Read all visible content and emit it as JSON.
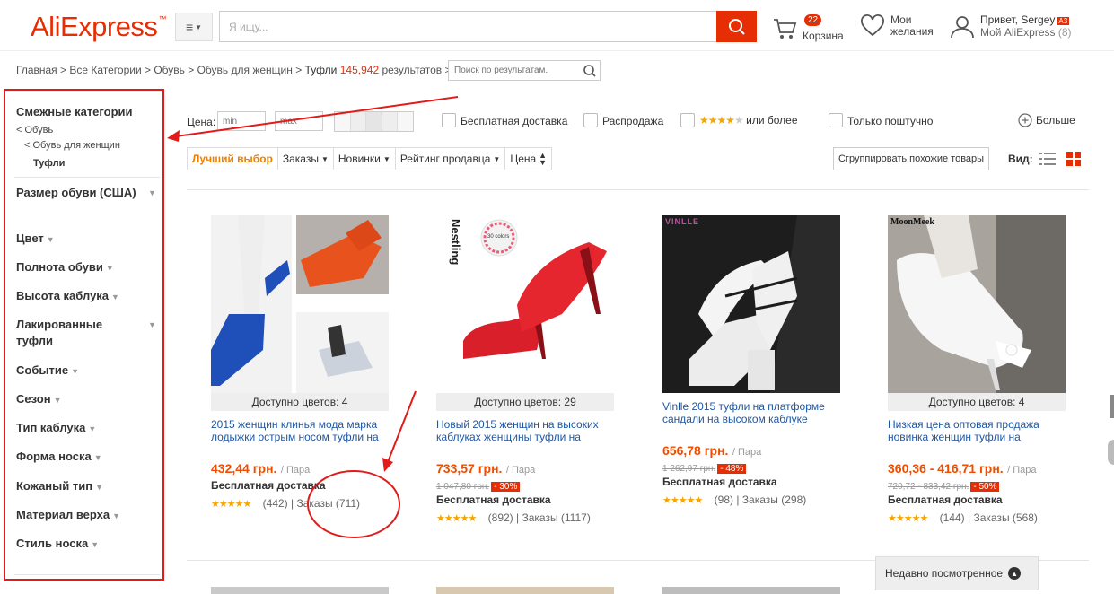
{
  "header": {
    "logo": "AliExpress",
    "logo_tm": "™",
    "search_placeholder": "Я ищу...",
    "cart_count": "22",
    "cart_label": "Корзина",
    "wish_line1": "Мои",
    "wish_line2": "желания",
    "greet_line1": "Привет, Sergey",
    "level_badge": "A3",
    "greet_line2": "Мой AliExpress",
    "greet_count": "(8)"
  },
  "breadcrumb": {
    "path": "Главная > Все Категории > Обувь > Обувь для женщин > ",
    "current": "Туфли",
    "count": "145,942",
    "results_label": "результатов",
    "arrow": ">",
    "search_placeholder": "Поиск по результатам."
  },
  "sidebar": {
    "title": "Смежные категории",
    "links": [
      "< Обувь",
      "< Обувь для женщин",
      "Туфли"
    ],
    "facets": [
      "Размер обуви (США)",
      "Цвет",
      "Полнота обуви",
      "Высота каблука",
      "Лакированные туфли",
      "Событие",
      "Сезон",
      "Тип каблука",
      "Форма носка",
      "Кожаный тип",
      "Материал верха",
      "Стиль носка"
    ]
  },
  "filters": {
    "price_label": "Цена:",
    "min_placeholder": "min",
    "max_placeholder": "max",
    "free_shipping": "Бесплатная доставка",
    "sale": "Распродажа",
    "rating_suffix": "или более",
    "single_piece": "Только поштучно",
    "more": "Больше"
  },
  "sort": {
    "items": [
      "Лучший выбор",
      "Заказы",
      "Новинки",
      "Рейтинг продавца",
      "Цена"
    ],
    "group_btn": "Сгруппировать похожие товары",
    "view_label": "Вид:"
  },
  "products": [
    {
      "colors": "Доступно цветов: 4",
      "title": "2015 женщин клинья мода марка лодыжки острым носом туфли на",
      "price": "432,44 грн.",
      "unit": "/ Пара",
      "old_price": "",
      "discount": "",
      "shipping": "Бесплатная доставка",
      "reviews": "(442)",
      "orders": "Заказы (711)"
    },
    {
      "colors": "Доступно цветов: 29",
      "title": "Новый 2015 женщин на высоких каблуках женщины туфли на",
      "price": "733,57 грн.",
      "unit": "/ Пара",
      "old_price": "1 047,80 грн.",
      "discount": "- 30%",
      "shipping": "Бесплатная доставка",
      "reviews": "(892)",
      "orders": "Заказы (1117)",
      "brand": "Nestling",
      "badge": "30 colors"
    },
    {
      "colors": "",
      "title": "Vinlle 2015 туфли на платформе сандали на высоком каблуке",
      "price": "656,78 грн.",
      "unit": "/ Пара",
      "old_price": "1 262,97 грн.",
      "discount": "- 48%",
      "shipping": "Бесплатная доставка",
      "reviews": "(98)",
      "orders": "Заказы (298)",
      "brand": "VINLLE"
    },
    {
      "colors": "Доступно цветов: 4",
      "title": "Низкая цена оптовая продажа новинка женщин туфли на",
      "price": "360,36 - 416,71 грн.",
      "unit": "/ Пара",
      "old_price": "720,72 - 833,42 грн.",
      "discount": "- 50%",
      "shipping": "Бесплатная доставка",
      "reviews": "(144)",
      "orders": "Заказы (568)",
      "brand": "MoonMeek"
    }
  ],
  "recent": "Недавно посмотренное",
  "colors": {
    "brand": "#e62e04",
    "annotation": "#e21a1a",
    "star": "#f6a600",
    "link": "#1c57a5"
  },
  "icons": [
    "menu-icon",
    "search-icon",
    "cart-icon",
    "heart-icon",
    "user-icon",
    "plus-circle-icon",
    "list-view-icon",
    "grid-view-icon"
  ]
}
